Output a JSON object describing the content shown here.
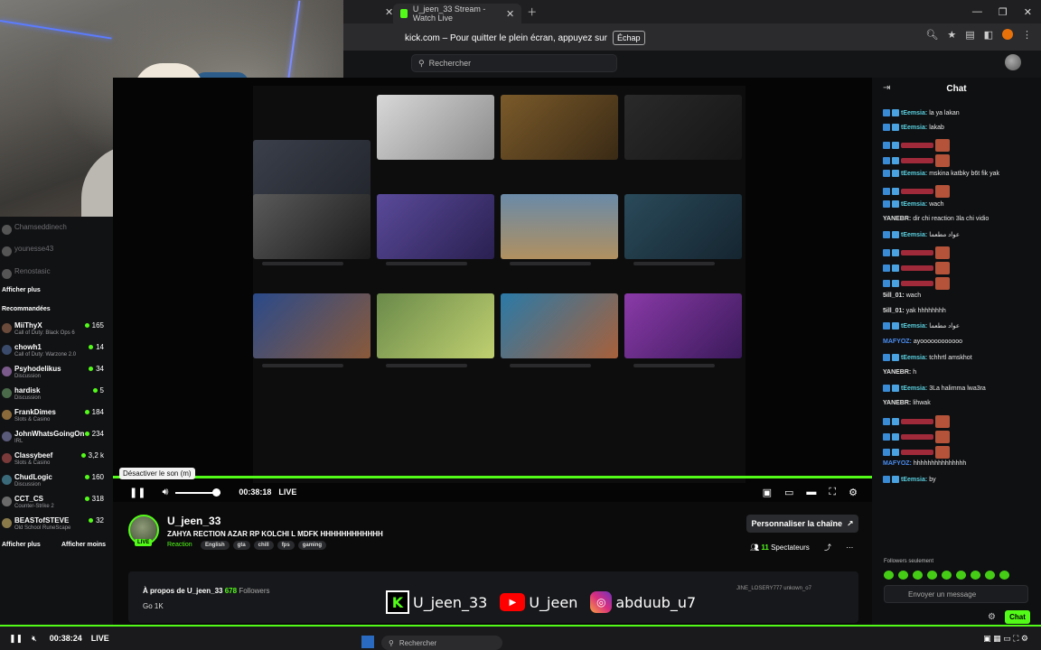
{
  "browser": {
    "tab_title": "U_jeen_33 Stream - Watch Live",
    "fullscreen_notice": "kick.com – Pour quitter le plein écran, appuyez sur",
    "fullscreen_key": "Échap"
  },
  "header": {
    "search_placeholder": "Rechercher"
  },
  "sidebar": {
    "top_items": [
      {
        "name": "Chamseddinech"
      },
      {
        "name": "younesse43"
      },
      {
        "name": "Renostasic"
      }
    ],
    "show_more": "Afficher plus",
    "recommended_title": "Recommandées",
    "recommended": [
      {
        "name": "MiiThyX",
        "category": "Call of Duty: Black Ops 6",
        "count": "165"
      },
      {
        "name": "chowh1",
        "category": "Call of Duty: Warzone 2.0",
        "count": "14"
      },
      {
        "name": "Psyhodelikus",
        "category": "Discussion",
        "count": "34"
      },
      {
        "name": "hardisk",
        "category": "Discussion",
        "count": "5"
      },
      {
        "name": "FrankDimes",
        "category": "Slots & Casino",
        "count": "184"
      },
      {
        "name": "JohnWhatsGoingOn",
        "category": "IRL",
        "count": "234"
      },
      {
        "name": "Classybeef",
        "category": "Slots & Casino",
        "count": "3,2 k"
      },
      {
        "name": "ChudLogic",
        "category": "Discussion",
        "count": "160"
      },
      {
        "name": "CCT_CS",
        "category": "Counter-Strike 2",
        "count": "318"
      },
      {
        "name": "BEASTofSTEVE",
        "category": "Old School RuneScape",
        "count": "32"
      }
    ],
    "show_more_bottom": "Afficher plus",
    "show_less": "Afficher moins"
  },
  "player": {
    "tooltip": "Désactiver le son (m)",
    "time": "00:38:18",
    "live_label": "LIVE",
    "volume": 0.9
  },
  "channel": {
    "name": "U_jeen_33",
    "title": "ZAHYA RECTION AZAR RP KOLCHI L MDFK HHHHHHHHHHHH",
    "category": "Reaction",
    "tags": [
      "English",
      "gta",
      "chill",
      "fps",
      "gaming"
    ],
    "live_badge": "LIVE",
    "customize_label": "Personnaliser la chaîne",
    "viewers_count": "11",
    "viewers_label": "Spectateurs",
    "about_prefix": "À propos de U_jeen_33",
    "followers_count": "678",
    "followers_label": "Followers",
    "description": "Go 1K",
    "about_links": "JINE_LOSERY777     unkown_o7"
  },
  "socials": {
    "kick_name": "U_jeen_33",
    "youtube_name": "U_jeen",
    "instagram_name": "abduub_u7"
  },
  "chat": {
    "title": "Chat",
    "messages": [
      {
        "user": "tEemsia:",
        "text": "la ya lakan",
        "style": "teal"
      },
      {
        "user": "tEemsia:",
        "text": "lakab",
        "style": "teal"
      },
      {
        "user": "YANEBR:",
        "text": "dir chi reaction 3la chi vidio",
        "style": "white"
      },
      {
        "user": "tEemsia:",
        "text": "mskina katbky b6t fik yak",
        "style": "teal"
      },
      {
        "user": "tEemsia:",
        "text": "wach",
        "style": "teal"
      },
      {
        "user": "tEemsia:",
        "text": "عواد مطعما",
        "style": "teal"
      },
      {
        "user": "5ill_01:",
        "text": "wach",
        "style": "white"
      },
      {
        "user": "5ill_01:",
        "text": "yak hhhhhhhh",
        "style": "white"
      },
      {
        "user": "tEemsia:",
        "text": "عواد مطعما",
        "style": "teal"
      },
      {
        "user": "MAFYOZ:",
        "text": "ayoooooooooooo",
        "style": "blue"
      },
      {
        "user": "tEemsia:",
        "text": "tchhrtl amskhot",
        "style": "teal"
      },
      {
        "user": "YANEBR:",
        "text": "h",
        "style": "white"
      },
      {
        "user": "tEemsia:",
        "text": "3La halimma lwa3ra",
        "style": "teal"
      },
      {
        "user": "YANEBR:",
        "text": "lihwak",
        "style": "white"
      },
      {
        "user": "MAFYOZ:",
        "text": "hhhhhhhhhhhhhhh",
        "style": "blue"
      },
      {
        "user": "tEemsia:",
        "text": "by",
        "style": "teal"
      }
    ],
    "followers_only": "Followers seulement",
    "input_placeholder": "Envoyer un message",
    "send_label": "Chat"
  },
  "taskbar": {
    "time": "00:38:24",
    "live_label": "LIVE",
    "search_placeholder": "Rechercher"
  },
  "colors": {
    "kick_green": "#53fc18",
    "background": "#0b0b0c"
  }
}
